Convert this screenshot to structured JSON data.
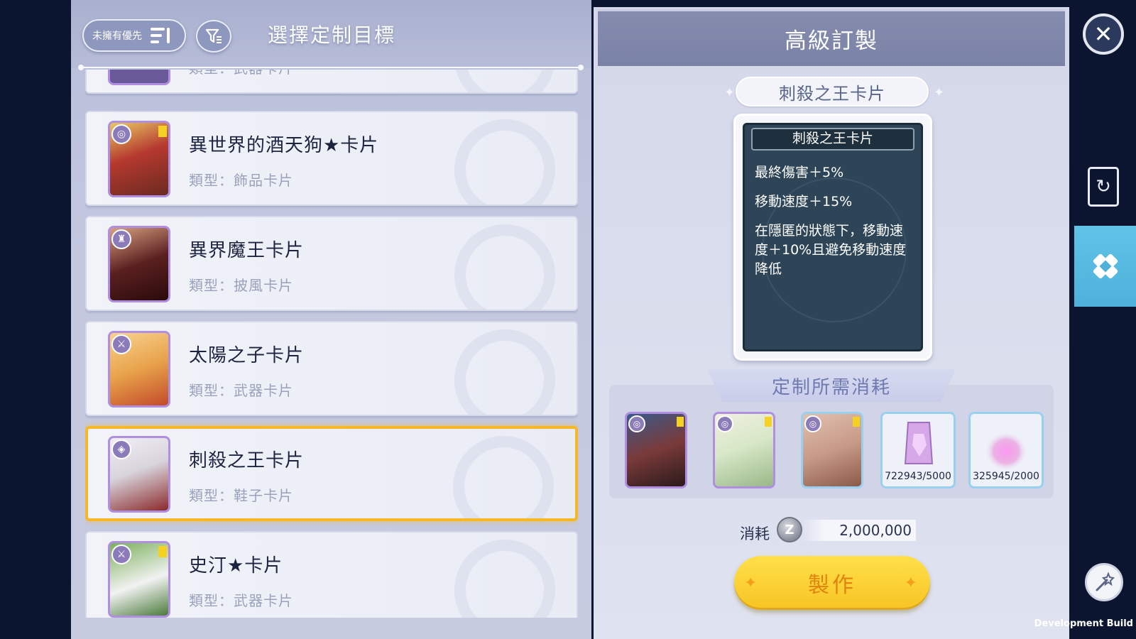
{
  "left": {
    "sort_label": "未擁有優先",
    "title": "選擇定制目標",
    "cards": [
      {
        "name": "",
        "type": "類型：武器卡片",
        "art": "#5a4a8a"
      },
      {
        "name": "異世界的酒天狗★卡片",
        "type": "類型：飾品卡片",
        "art": "#b5392f",
        "slot_icon": "accessory",
        "starred": true
      },
      {
        "name": "異界魔王卡片",
        "type": "類型：披風卡片",
        "art": "#5a2020",
        "slot_icon": "cape",
        "starred": false
      },
      {
        "name": "太陽之子卡片",
        "type": "類型：武器卡片",
        "art": "#e8a24a",
        "slot_icon": "weapon",
        "starred": false
      },
      {
        "name": "刺殺之王卡片",
        "type": "類型：鞋子卡片",
        "art": "#d8d4dc",
        "slot_icon": "shoes",
        "starred": false,
        "selected": true
      },
      {
        "name": "史汀★卡片",
        "type": "類型：武器卡片",
        "art": "#4a7a3a",
        "slot_icon": "weapon",
        "starred": true
      }
    ]
  },
  "right": {
    "title": "高級訂製",
    "target_name": "刺殺之王卡片",
    "detail": {
      "title": "刺殺之王卡片",
      "effect_1": "最終傷害＋5%",
      "effect_2": "移動速度＋15%",
      "effect_3": "在隱匿的狀態下，移動速度＋10%且避免移動速度降低"
    },
    "cost_title": "定制所需消耗",
    "materials": [
      {
        "kind": "card",
        "art": "#7a3a3a",
        "starred": true
      },
      {
        "kind": "card",
        "art": "#d8e8c8",
        "starred": true
      },
      {
        "kind": "card",
        "art": "#c89a88",
        "starred": true
      },
      {
        "kind": "item",
        "count": "722943/5000",
        "art": "#d6a8e8"
      },
      {
        "kind": "item",
        "count": "325945/2000",
        "art": "#e88ad8"
      }
    ],
    "cost_label": "消耗",
    "currency_symbol": "Z",
    "cost_value": "2,000,000",
    "craft_label": "製作"
  },
  "sidebar": {
    "close_symbol": "✕"
  },
  "footer": {
    "build_label": "Development Build"
  }
}
